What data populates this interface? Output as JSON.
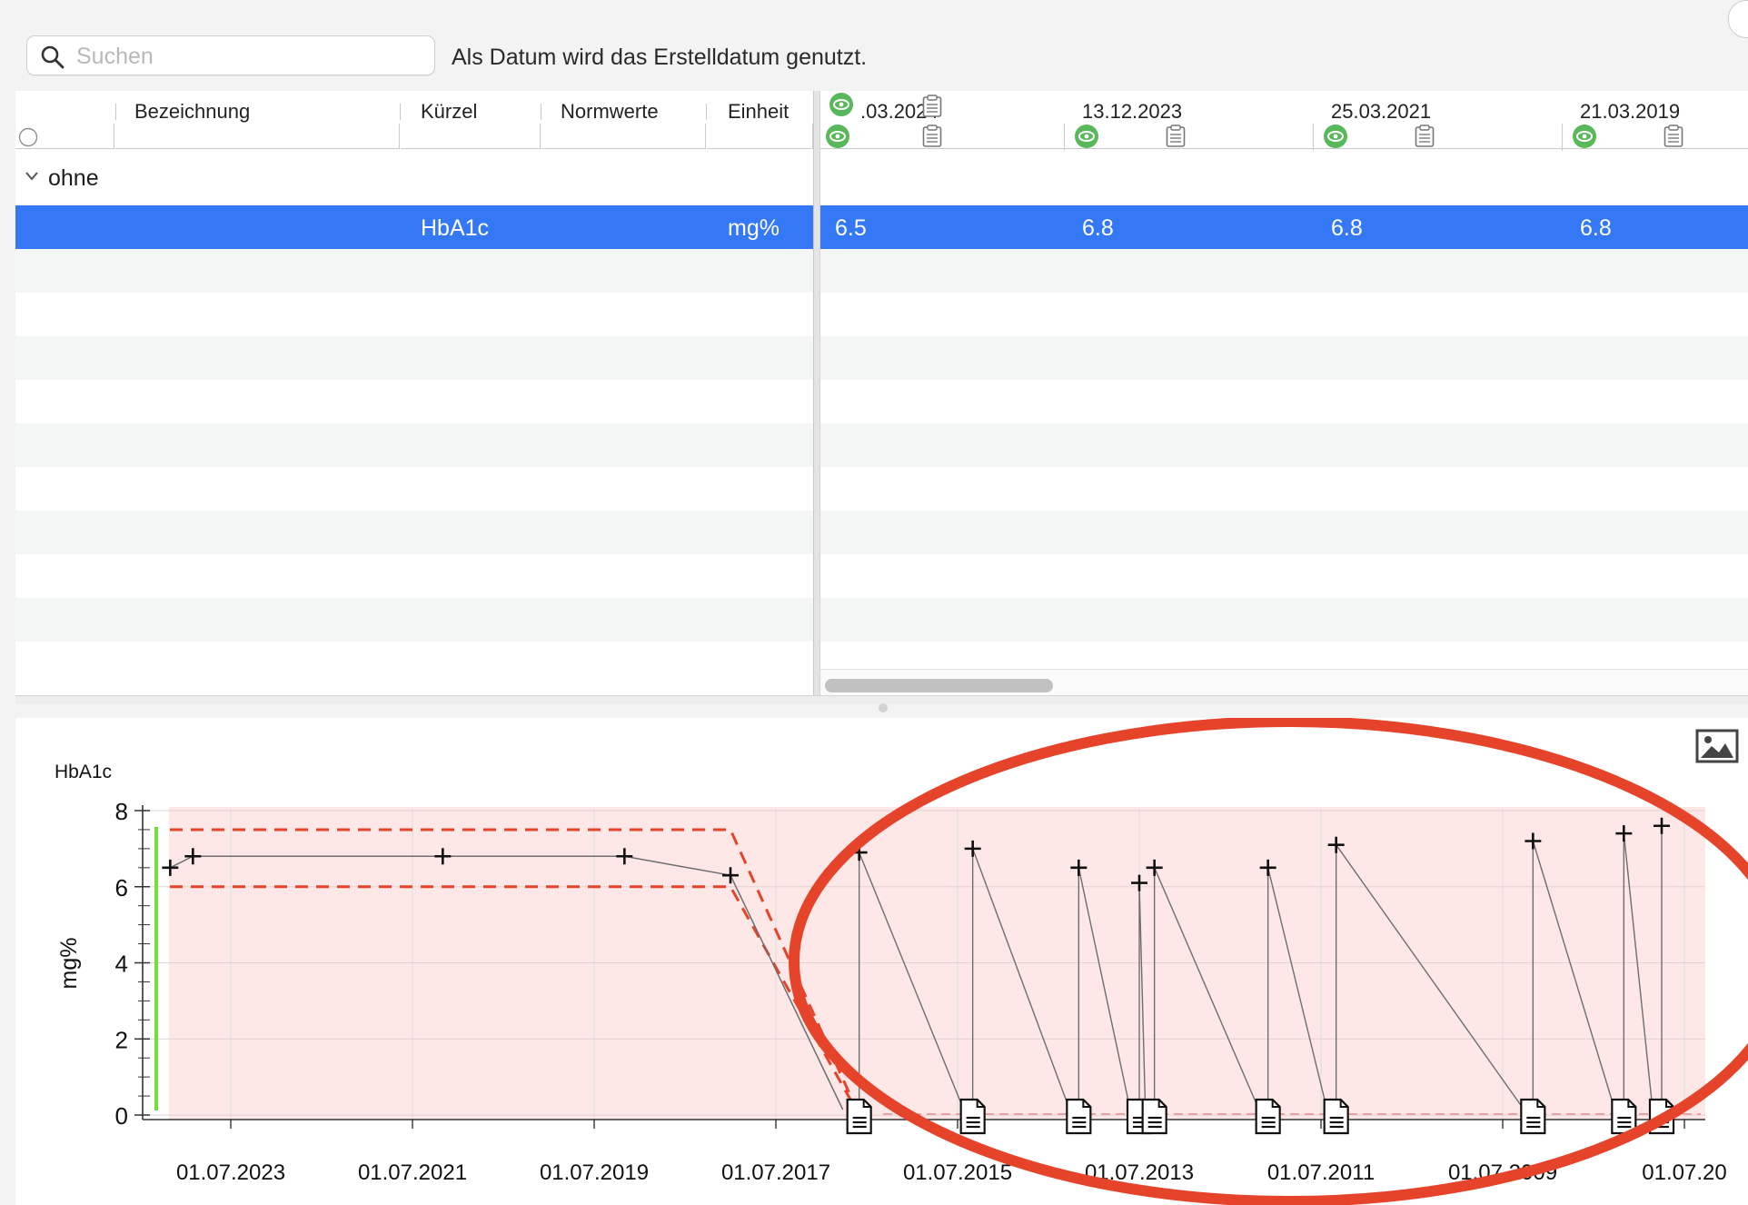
{
  "toolbar": {
    "search_placeholder": "Suchen",
    "note": "Als Datum wird das Erstelldatum genutzt."
  },
  "table": {
    "columns": [
      "Bezeichnung",
      "Kürzel",
      "Normwerte",
      "Einheit"
    ],
    "group_label": "ohne",
    "selected_row": {
      "abbreviation": "HbA1c",
      "unit": "mg%"
    },
    "date_columns": [
      {
        "date": ".03.2024",
        "value": "6.5"
      },
      {
        "date": "13.12.2023",
        "value": "6.8"
      },
      {
        "date": "25.03.2021",
        "value": "6.8"
      },
      {
        "date": "21.03.2019",
        "value": "6.8"
      }
    ]
  },
  "chart": {
    "title": "HbA1c",
    "ylabel": "mg%",
    "colors": {
      "normal_band": "#fde7e7",
      "range_line": "#e5432a",
      "series_line": "#6e6e6e",
      "marker": "#111111",
      "latest_bar": "#6fe03c",
      "annotation": "#e5432a"
    }
  },
  "chart_data": {
    "type": "line",
    "xlabel": "",
    "ylabel": "mg%",
    "title": "HbA1c",
    "x_tick_labels": [
      "01.07.2023",
      "01.07.2021",
      "01.07.2019",
      "01.07.2017",
      "01.07.2015",
      "01.07.2013",
      "01.07.2011",
      "01.07.2009",
      "01.07.20"
    ],
    "y_ticks": [
      0,
      2,
      4,
      6,
      8
    ],
    "ylim": [
      0,
      8
    ],
    "grid": true,
    "x_axis_reversed": true,
    "series": [
      {
        "x": [
          "2024-03",
          "2023-12",
          "2021-03",
          "2019-03",
          "2018-01",
          "2016-08",
          "2015-05",
          "2014-03",
          "2013-07",
          "2013-05",
          "2012-02",
          "2011-05",
          "2009-03",
          "2008-03",
          "2007-10"
        ],
        "values": [
          6.5,
          6.8,
          6.8,
          6.8,
          6.3,
          6.9,
          7.0,
          6.5,
          6.1,
          6.5,
          6.5,
          7.1,
          7.2,
          7.4,
          7.6
        ]
      }
    ],
    "reference_band": {
      "x": [
        "2024-03",
        "2023-12",
        "2021-03",
        "2019-03",
        "2018-01",
        "2016-08"
      ],
      "upper": [
        7.5,
        7.5,
        7.5,
        7.5,
        7.5,
        0
      ],
      "lower": [
        6.0,
        6.0,
        6.0,
        6.0,
        6.0,
        0
      ]
    },
    "document_markers_at_y": 0
  }
}
